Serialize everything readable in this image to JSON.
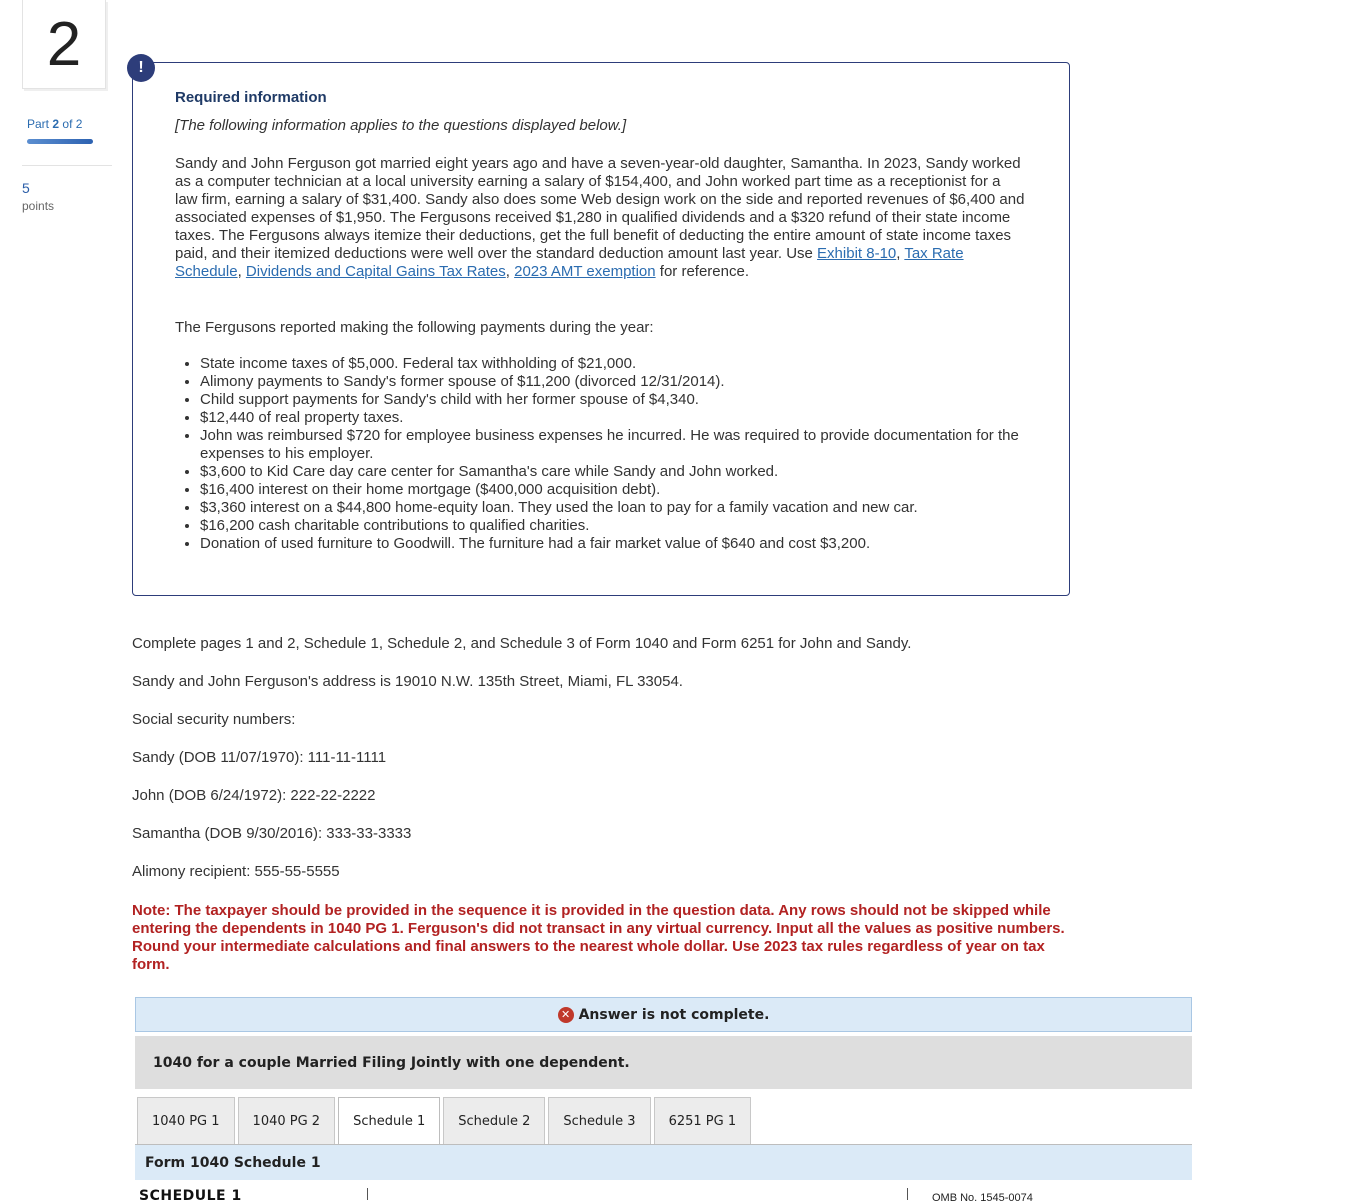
{
  "question": {
    "number": "2",
    "part_word": "Part",
    "part_current": "2",
    "part_of": "of 2",
    "points_value": "5",
    "points_label": "points"
  },
  "required_info": {
    "icon": "exclamation-icon",
    "icon_glyph": "!",
    "title": "Required information",
    "note": "[The following information applies to the questions displayed below.]",
    "paragraph": "Sandy and John Ferguson got married eight years ago and have a seven-year-old daughter, Samantha. In 2023, Sandy worked as a computer technician at a local university earning a salary of $154,400, and John worked part time as a receptionist for a law firm, earning a salary of $31,400. Sandy also does some Web design work on the side and reported revenues of $6,400 and associated expenses of $1,950. The Fergusons received $1,280 in qualified dividends and a $320 refund of their state income taxes. The Fergusons always itemize their deductions, get the full benefit of deducting the entire amount of state income taxes paid, and their itemized deductions were well over the standard deduction amount last year. Use",
    "links": [
      "Exhibit 8-10",
      "Tax Rate Schedule",
      "Dividends and Capital Gains Tax Rates",
      "2023 AMT exemption"
    ],
    "sep": ", ",
    "paragraph_end": " for reference.",
    "payments_intro": "The Fergusons reported making the following payments during the year:",
    "payments": [
      "State income taxes of $5,000. Federal tax withholding of $21,000.",
      "Alimony payments to Sandy's former spouse of $11,200 (divorced 12/31/2014).",
      "Child support payments for Sandy's child with her former spouse of $4,340.",
      "$12,440 of real property taxes.",
      "John was reimbursed $720 for employee business expenses he incurred. He was required to provide documentation for the expenses to his employer.",
      "$3,600 to Kid Care day care center for Samantha's care while Sandy and John worked.",
      "$16,400 interest on their home mortgage ($400,000 acquisition debt).",
      "$3,360 interest on a $44,800 home-equity loan. They used the loan to pay for a family vacation and new car.",
      "$16,200 cash charitable contributions to qualified charities.",
      "Donation of used furniture to Goodwill. The furniture had a fair market value of $640 and cost $3,200."
    ]
  },
  "instructions": {
    "line1": "Complete pages 1 and 2, Schedule 1, Schedule 2, and Schedule 3 of Form 1040 and Form 6251 for John and Sandy.",
    "line2": "Sandy and John Ferguson's address is 19010 N.W. 135th Street, Miami, FL 33054.",
    "line3": "Social security numbers:",
    "line4": "Sandy (DOB 11/07/1970): 111-11-1111",
    "line5": "John (DOB 6/24/1972): 222-22-2222",
    "line6": "Samantha (DOB 9/30/2016): 333-33-3333",
    "line7": "Alimony recipient: 555-55-5555",
    "note": "Note: The taxpayer should be provided in the sequence it is provided in the question data. Any rows should not be skipped while entering the dependents in 1040 PG 1. Ferguson's did not transact in any virtual currency. Input all the values as positive numbers. Round your intermediate calculations and final answers to the nearest whole dollar. Use 2023 tax rules regardless of year on tax form."
  },
  "answer": {
    "status_icon": "x-circle-icon",
    "status_glyph": "✕",
    "status": "Answer is not complete.",
    "subtitle": "1040 for a couple Married Filing Jointly with one dependent.",
    "tabs": [
      "1040 PG 1",
      "1040 PG 2",
      "Schedule 1",
      "Schedule 2",
      "Schedule 3",
      "6251 PG 1"
    ],
    "active_tab": "Schedule 1",
    "form_title": "Form 1040 Schedule 1",
    "schedule_label": "SCHEDULE 1",
    "omb": "OMB No. 1545-0074"
  },
  "colors": {
    "link": "#2b6cb0",
    "note_red": "#b22222",
    "box_border": "#2d3d7a",
    "banner_blue": "#dbeaf7"
  }
}
